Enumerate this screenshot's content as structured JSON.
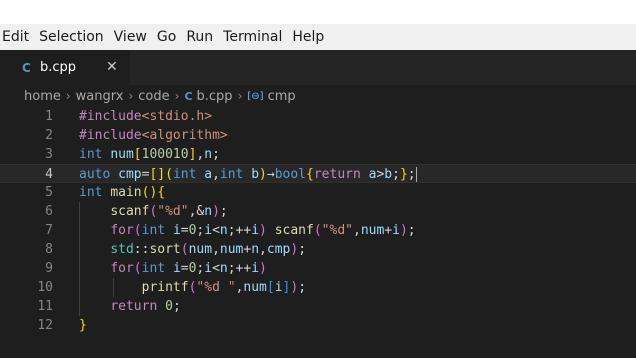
{
  "menu": [
    "Edit",
    "Selection",
    "View",
    "Go",
    "Run",
    "Terminal",
    "Help"
  ],
  "tab": {
    "label": "b.cpp",
    "file_icon": "cpp-file-icon",
    "close_glyph": "✕"
  },
  "breadcrumb": {
    "parts": [
      "home",
      "wangrx",
      "code"
    ],
    "file": "b.cpp",
    "symbol": "cmp",
    "separator": "›"
  },
  "editor": {
    "current_line": 4,
    "lines": [
      {
        "n": "1",
        "tokens": [
          [
            "pp",
            "#include"
          ],
          [
            "inc",
            "<stdio.h>"
          ]
        ]
      },
      {
        "n": "2",
        "tokens": [
          [
            "pp",
            "#include"
          ],
          [
            "inc",
            "<algorithm>"
          ]
        ]
      },
      {
        "n": "3",
        "tokens": [
          [
            "kw",
            "int"
          ],
          [
            "op",
            " "
          ],
          [
            "var",
            "num"
          ],
          [
            "br1",
            "["
          ],
          [
            "num",
            "100010"
          ],
          [
            "br1",
            "]"
          ],
          [
            "op",
            ","
          ],
          [
            "var",
            "n"
          ],
          [
            "op",
            ";"
          ]
        ]
      },
      {
        "n": "4",
        "tokens": [
          [
            "kw",
            "auto"
          ],
          [
            "op",
            " "
          ],
          [
            "var",
            "cmp"
          ],
          [
            "op",
            "="
          ],
          [
            "br1",
            "[]"
          ],
          [
            "br1",
            "("
          ],
          [
            "kw",
            "int"
          ],
          [
            "op",
            " "
          ],
          [
            "var",
            "a"
          ],
          [
            "op",
            ","
          ],
          [
            "kw",
            "int"
          ],
          [
            "op",
            " "
          ],
          [
            "var",
            "b"
          ],
          [
            "br1",
            ")"
          ],
          [
            "op",
            "→"
          ],
          [
            "kw",
            "bool"
          ],
          [
            "br1",
            "{"
          ],
          [
            "pp",
            "return"
          ],
          [
            "op",
            " "
          ],
          [
            "var",
            "a"
          ],
          [
            "op",
            ">"
          ],
          [
            "var",
            "b"
          ],
          [
            "op",
            ";"
          ],
          [
            "br1",
            "}"
          ],
          [
            "op",
            ";"
          ]
        ]
      },
      {
        "n": "5",
        "tokens": [
          [
            "kw",
            "int"
          ],
          [
            "op",
            " "
          ],
          [
            "fn",
            "main"
          ],
          [
            "br1",
            "()"
          ],
          [
            "br1",
            "{"
          ]
        ]
      },
      {
        "n": "6",
        "tokens": [
          [
            "op",
            "    "
          ],
          [
            "fn",
            "scanf"
          ],
          [
            "br2",
            "("
          ],
          [
            "str",
            "\"%d\""
          ],
          [
            "op",
            ",&"
          ],
          [
            "var",
            "n"
          ],
          [
            "br2",
            ")"
          ],
          [
            "op",
            ";"
          ]
        ]
      },
      {
        "n": "7",
        "tokens": [
          [
            "op",
            "    "
          ],
          [
            "pp",
            "for"
          ],
          [
            "br2",
            "("
          ],
          [
            "kw",
            "int"
          ],
          [
            "op",
            " "
          ],
          [
            "var",
            "i"
          ],
          [
            "op",
            "="
          ],
          [
            "num",
            "0"
          ],
          [
            "op",
            ";"
          ],
          [
            "var",
            "i"
          ],
          [
            "op",
            "<"
          ],
          [
            "var",
            "n"
          ],
          [
            "op",
            ";++"
          ],
          [
            "var",
            "i"
          ],
          [
            "br2",
            ")"
          ],
          [
            "op",
            " "
          ],
          [
            "fn",
            "scanf"
          ],
          [
            "br2",
            "("
          ],
          [
            "str",
            "\"%d\""
          ],
          [
            "op",
            ","
          ],
          [
            "var",
            "num"
          ],
          [
            "op",
            "+"
          ],
          [
            "var",
            "i"
          ],
          [
            "br2",
            ")"
          ],
          [
            "op",
            ";"
          ]
        ]
      },
      {
        "n": "8",
        "tokens": [
          [
            "op",
            "    "
          ],
          [
            "ns",
            "std"
          ],
          [
            "op",
            "::"
          ],
          [
            "fn",
            "sort"
          ],
          [
            "br2",
            "("
          ],
          [
            "var",
            "num"
          ],
          [
            "op",
            ","
          ],
          [
            "var",
            "num"
          ],
          [
            "op",
            "+"
          ],
          [
            "var",
            "n"
          ],
          [
            "op",
            ","
          ],
          [
            "var",
            "cmp"
          ],
          [
            "br2",
            ")"
          ],
          [
            "op",
            ";"
          ]
        ]
      },
      {
        "n": "9",
        "tokens": [
          [
            "op",
            "    "
          ],
          [
            "pp",
            "for"
          ],
          [
            "br2",
            "("
          ],
          [
            "kw",
            "int"
          ],
          [
            "op",
            " "
          ],
          [
            "var",
            "i"
          ],
          [
            "op",
            "="
          ],
          [
            "num",
            "0"
          ],
          [
            "op",
            ";"
          ],
          [
            "var",
            "i"
          ],
          [
            "op",
            "<"
          ],
          [
            "var",
            "n"
          ],
          [
            "op",
            ";++"
          ],
          [
            "var",
            "i"
          ],
          [
            "br2",
            ")"
          ]
        ]
      },
      {
        "n": "10",
        "tokens": [
          [
            "op",
            "        "
          ],
          [
            "fn",
            "printf"
          ],
          [
            "br2",
            "("
          ],
          [
            "str",
            "\"%d \""
          ],
          [
            "op",
            ","
          ],
          [
            "var",
            "num"
          ],
          [
            "br3",
            "["
          ],
          [
            "var",
            "i"
          ],
          [
            "br3",
            "]"
          ],
          [
            "br2",
            ")"
          ],
          [
            "op",
            ";"
          ]
        ]
      },
      {
        "n": "11",
        "tokens": [
          [
            "op",
            "    "
          ],
          [
            "pp",
            "return"
          ],
          [
            "op",
            " "
          ],
          [
            "num",
            "0"
          ],
          [
            "op",
            ";"
          ]
        ]
      },
      {
        "n": "12",
        "tokens": [
          [
            "br1",
            "}"
          ]
        ]
      }
    ]
  },
  "colors": {
    "background": "#1e1e1e",
    "keyword": "#569cd6",
    "control": "#c586c0",
    "string": "#ce9178",
    "function": "#dcdcaa",
    "number": "#b5cea8",
    "variable": "#9cdcfe"
  }
}
